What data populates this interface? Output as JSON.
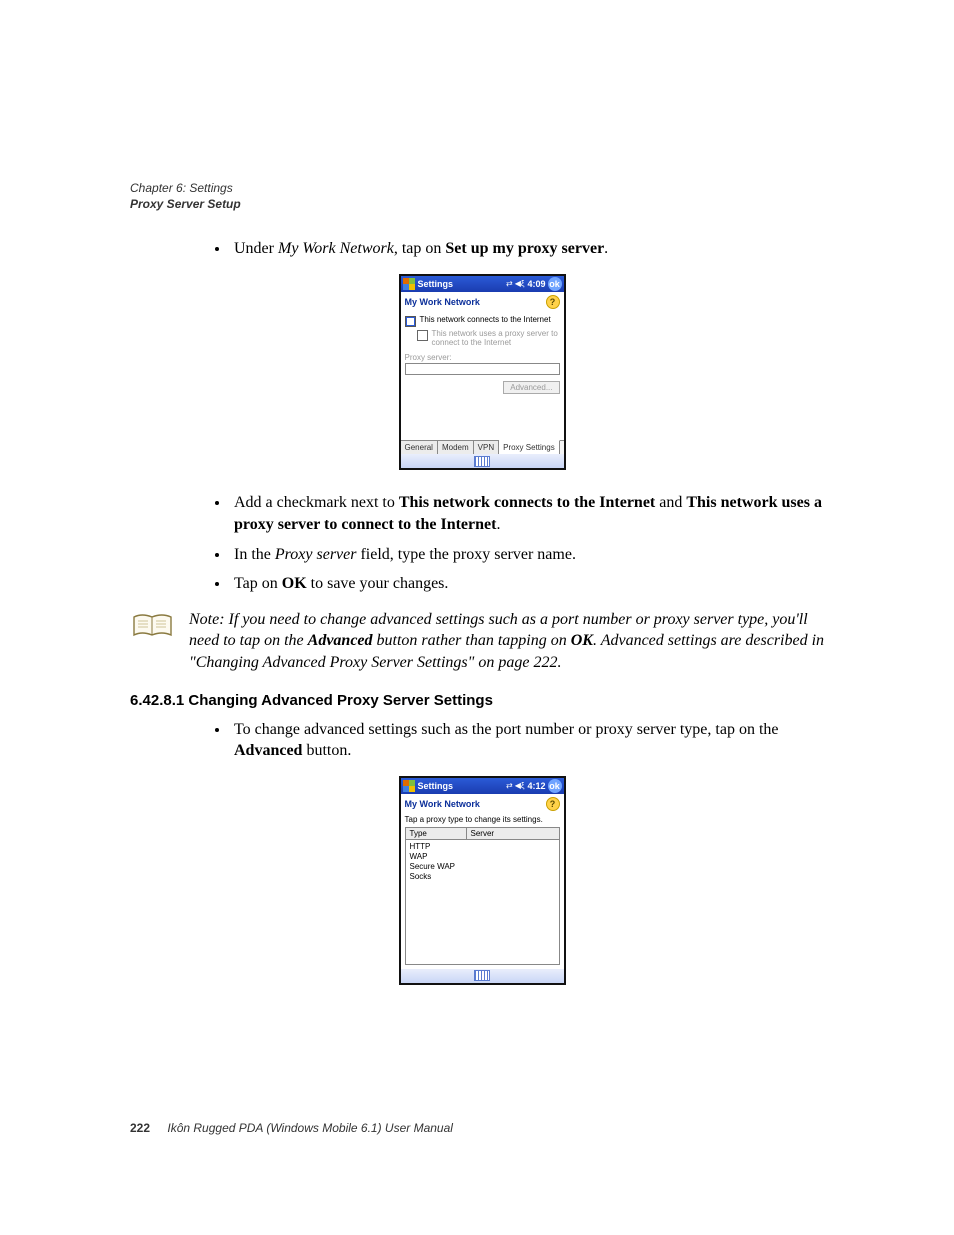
{
  "header": {
    "chapter": "Chapter 6:  Settings",
    "section": "Proxy Server Setup"
  },
  "bullets_top": [
    {
      "pre": "Under ",
      "em": "My Work Network",
      "mid": ", tap on ",
      "bold": "Set up my proxy server",
      "post": "."
    }
  ],
  "screen1": {
    "titlebar": {
      "title": "Settings",
      "time": "4:09",
      "ok": "ok"
    },
    "subheader": "My Work Network",
    "chk1": "This network connects to the Internet",
    "chk2": "This network uses a proxy server to connect to the Internet",
    "proxy_label": "Proxy server:",
    "advanced_btn": "Advanced...",
    "tabs": [
      "General",
      "Modem",
      "VPN",
      "Proxy Settings"
    ]
  },
  "bullets_mid": {
    "b1_pre": "Add a checkmark next to ",
    "b1_bold1": "This network connects to the Internet",
    "b1_mid": " and ",
    "b1_bold2": "This network uses a proxy server to connect to the Internet",
    "b1_post": ".",
    "b2_pre": "In the ",
    "b2_em": "Proxy server",
    "b2_post": " field, type the proxy server name.",
    "b3_pre": "Tap on ",
    "b3_bold": "OK",
    "b3_post": " to save your changes."
  },
  "note": {
    "lead": "Note:",
    "l1": "If you need to change advanced settings such as a port number or proxy server type, you'll need to tap on the ",
    "bold1": "Advanced",
    "l2": " button rather than tapping on ",
    "bold2": "OK",
    "l3": ". Advanced settings are described in \"Changing Advanced Proxy Server Settings\" on page 222."
  },
  "heading": "6.42.8.1 Changing Advanced Proxy Server Settings",
  "bullets_bot": {
    "pre": "To change advanced settings such as the port number or proxy server type, tap on the ",
    "bold": "Advanced",
    "post": " button."
  },
  "screen2": {
    "titlebar": {
      "title": "Settings",
      "time": "4:12",
      "ok": "ok"
    },
    "subheader": "My Work Network",
    "instruction": "Tap a proxy type to change its settings.",
    "columns": {
      "type": "Type",
      "server": "Server"
    },
    "rows": [
      "HTTP",
      "WAP",
      "Secure WAP",
      "Socks"
    ]
  },
  "footer": {
    "page": "222",
    "text": "Ikôn Rugged PDA (Windows Mobile 6.1) User Manual"
  }
}
